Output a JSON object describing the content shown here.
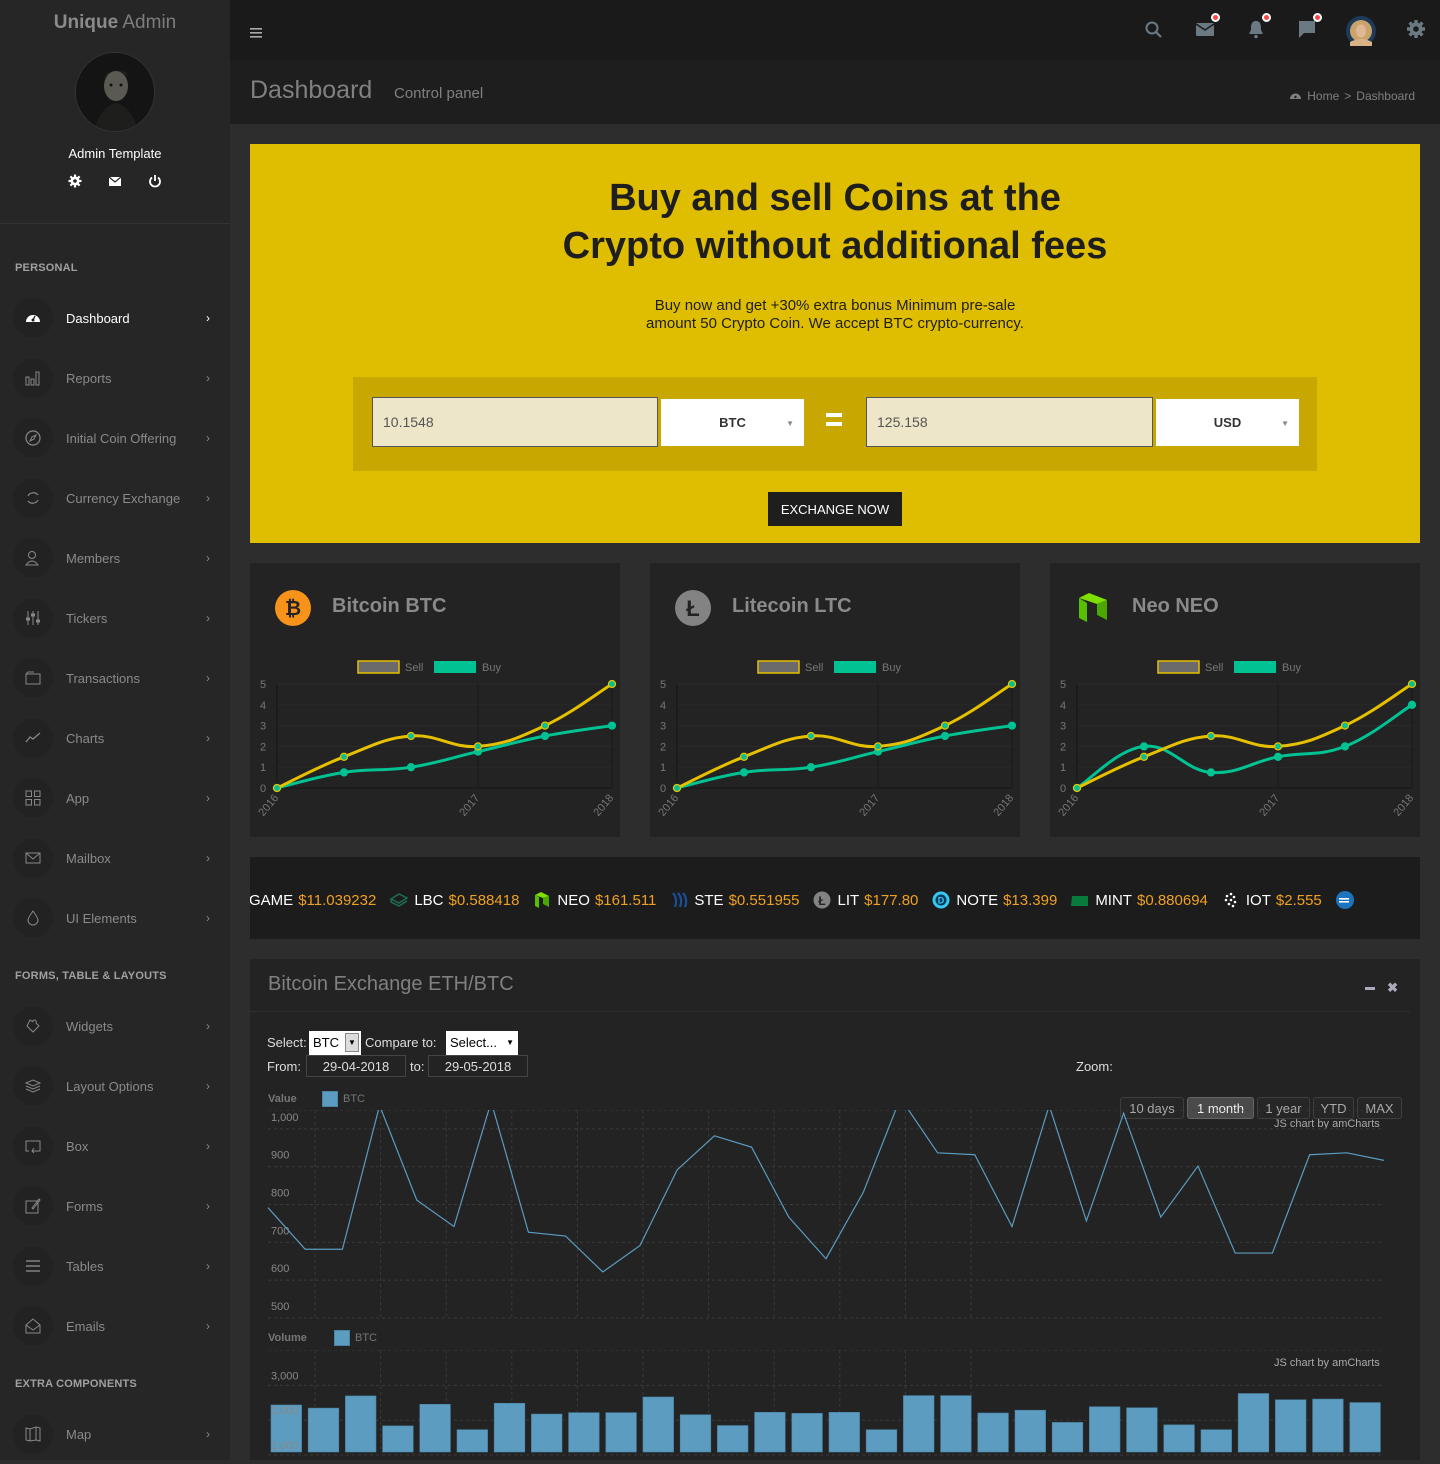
{
  "app": {
    "brand_bold": "Unique",
    "brand_light": " Admin"
  },
  "user": {
    "name": "Admin Template",
    "icons": [
      "gear-icon",
      "mail-icon",
      "power-icon"
    ]
  },
  "sidebar": {
    "sections": [
      {
        "header": "PERSONAL",
        "items": [
          {
            "label": "Dashboard",
            "icon": "dashboard-icon",
            "active": true
          },
          {
            "label": "Reports",
            "icon": "bar-chart-icon"
          },
          {
            "label": "Initial Coin Offering",
            "icon": "compass-icon"
          },
          {
            "label": "Currency Exchange",
            "icon": "refresh-icon"
          },
          {
            "label": "Members",
            "icon": "users-icon"
          },
          {
            "label": "Tickers",
            "icon": "sliders-icon"
          },
          {
            "label": "Transactions",
            "icon": "wallet-icon"
          },
          {
            "label": "Charts",
            "icon": "trend-icon"
          },
          {
            "label": "App",
            "icon": "grid-icon"
          },
          {
            "label": "Mailbox",
            "icon": "mail-icon"
          },
          {
            "label": "UI Elements",
            "icon": "drop-icon"
          }
        ]
      },
      {
        "header": "FORMS, TABLE & LAYOUTS",
        "items": [
          {
            "label": "Widgets",
            "icon": "puzzle-icon"
          },
          {
            "label": "Layout Options",
            "icon": "layers-icon"
          },
          {
            "label": "Box",
            "icon": "box-icon"
          },
          {
            "label": "Forms",
            "icon": "edit-icon"
          },
          {
            "label": "Tables",
            "icon": "menu-icon"
          },
          {
            "label": "Emails",
            "icon": "envelope-open-icon"
          }
        ]
      },
      {
        "header": "EXTRA COMPONENTS",
        "items": [
          {
            "label": "Map",
            "icon": "map-icon"
          }
        ]
      }
    ]
  },
  "topbar": {
    "icons": [
      "search-icon",
      "mail-icon",
      "bell-icon",
      "chat-icon",
      "user-avatar",
      "gear-icon"
    ]
  },
  "page": {
    "title": "Dashboard",
    "subtitle": "Control panel",
    "breadcrumb": [
      "Home",
      "Dashboard"
    ]
  },
  "hero": {
    "title_line1": "Buy and sell Coins at the",
    "title_line2": "Crypto without additional fees",
    "text_line1": "Buy now and get +30% extra bonus Minimum pre-sale",
    "text_line2": "amount 50 Crypto Coin. We accept BTC crypto-currency.",
    "from_amount": "10.1548",
    "from_currency": "BTC",
    "to_amount": "125.158",
    "to_currency": "USD",
    "button": "EXCHANGE NOW",
    "color": "#dfbd00"
  },
  "coins": [
    {
      "name": "Bitcoin BTC",
      "icon": "bitcoin-icon",
      "color": "#f7931a"
    },
    {
      "name": "Litecoin LTC",
      "icon": "litecoin-icon",
      "color": "#838383"
    },
    {
      "name": "Neo NEO",
      "icon": "neo-icon",
      "color": "#58bf00"
    }
  ],
  "chart_data": [
    {
      "type": "line",
      "title": "Bitcoin BTC",
      "x": [
        "2016",
        "",
        "",
        "2017",
        "",
        "2018"
      ],
      "tick_labels": [
        "2016",
        "2017",
        "2018"
      ],
      "ylim": [
        0,
        5
      ],
      "yticks": [
        0,
        1,
        2,
        3,
        4,
        5
      ],
      "legend": [
        "Sell",
        "Buy"
      ],
      "series": [
        {
          "name": "Sell",
          "color": "#e6c000",
          "values": [
            0,
            1.5,
            2.5,
            2,
            3,
            5
          ]
        },
        {
          "name": "Buy",
          "color": "#00c292",
          "values": [
            0,
            0.75,
            1,
            1.75,
            2.5,
            3
          ]
        }
      ]
    },
    {
      "type": "line",
      "title": "Litecoin LTC",
      "x": [
        "2016",
        "",
        "",
        "2017",
        "",
        "2018"
      ],
      "tick_labels": [
        "2016",
        "2017",
        "2018"
      ],
      "ylim": [
        0,
        5
      ],
      "yticks": [
        0,
        1,
        2,
        3,
        4,
        5
      ],
      "legend": [
        "Sell",
        "Buy"
      ],
      "series": [
        {
          "name": "Sell",
          "color": "#e6c000",
          "values": [
            0,
            1.5,
            2.5,
            2,
            3,
            5
          ]
        },
        {
          "name": "Buy",
          "color": "#00c292",
          "values": [
            0,
            0.75,
            1,
            1.75,
            2.5,
            3
          ]
        }
      ]
    },
    {
      "type": "line",
      "title": "Neo NEO",
      "x": [
        "2016",
        "",
        "",
        "2017",
        "",
        "2018"
      ],
      "tick_labels": [
        "2016",
        "2017",
        "2018"
      ],
      "ylim": [
        0,
        5
      ],
      "yticks": [
        0,
        1,
        2,
        3,
        4,
        5
      ],
      "legend": [
        "Sell",
        "Buy"
      ],
      "series": [
        {
          "name": "Sell",
          "color": "#e6c000",
          "values": [
            0,
            1.5,
            2.5,
            2,
            3,
            5
          ]
        },
        {
          "name": "Buy",
          "color": "#00c292",
          "values": [
            0,
            2,
            0.75,
            1.5,
            2,
            4
          ]
        }
      ]
    },
    {
      "type": "line",
      "title": "Value",
      "legend": [
        "BTC"
      ],
      "ylim": [
        500,
        1050
      ],
      "yticks": [
        500,
        600,
        700,
        800,
        900,
        1000
      ],
      "ytick_labels": [
        "500",
        "600",
        "700",
        "800",
        "900",
        "1,000"
      ],
      "series": [
        {
          "name": "BTC",
          "color": "#5b9cc0",
          "values": [
            760,
            650,
            650,
            1030,
            780,
            710,
            1040,
            695,
            685,
            590,
            660,
            860,
            950,
            920,
            735,
            625,
            800,
            1050,
            905,
            900,
            710,
            1030,
            725,
            1010,
            735,
            870,
            640,
            640,
            900,
            905,
            885
          ]
        }
      ],
      "credit": "JS chart by amCharts"
    },
    {
      "type": "bar",
      "title": "Volume",
      "legend": [
        "BTC"
      ],
      "ylim": [
        800,
        3500
      ],
      "yticks": [
        1000,
        2000,
        3000
      ],
      "ytick_labels": [
        "1,000",
        "2,000",
        "3,000"
      ],
      "series": [
        {
          "name": "BTC",
          "color": "#5b9cc0",
          "values": [
            2150,
            2060,
            2410,
            1550,
            2170,
            1440,
            2200,
            1890,
            1930,
            1930,
            2380,
            1870,
            1560,
            1940,
            1910,
            1940,
            1440,
            2420,
            2420,
            1920,
            2000,
            1650,
            2100,
            2070,
            1580,
            1440,
            2480,
            2300,
            2320,
            2220
          ]
        }
      ],
      "credit": "JS chart by amCharts"
    }
  ],
  "ticker": [
    {
      "symbol": "GAME",
      "price": "$11.039232",
      "icon": "game-icon",
      "color": "#2e77bc"
    },
    {
      "symbol": "LBC",
      "price": "$0.588418",
      "icon": "lbc-icon",
      "color": "#1d6e52"
    },
    {
      "symbol": "NEO",
      "price": "$161.511",
      "icon": "neo-icon",
      "color": "#58bf00"
    },
    {
      "symbol": "STE",
      "price": "$0.551955",
      "icon": "steem-icon",
      "color": "#1a5099"
    },
    {
      "symbol": "LIT",
      "price": "$177.80",
      "icon": "litecoin-icon",
      "color": "#838383"
    },
    {
      "symbol": "NOTE",
      "price": "$13.399",
      "icon": "dnote-icon",
      "color": "#34c9f0"
    },
    {
      "symbol": "MINT",
      "price": "$0.880694",
      "icon": "mint-icon",
      "color": "#087a3b"
    },
    {
      "symbol": "IOT",
      "price": "$2.555",
      "icon": "iota-icon",
      "color": "#ffffff"
    },
    {
      "symbol": "",
      "price": "",
      "icon": "dash-icon",
      "color": "#1c75bc"
    }
  ],
  "exchange_panel": {
    "title": "Bitcoin Exchange ETH/BTC",
    "select_label": "Select:",
    "select_value": "BTC",
    "compare_label": "Compare to:",
    "compare_value": "Select...",
    "from_label": "From:",
    "from_date": "29-04-2018",
    "to_label": "to:",
    "to_date": "29-05-2018",
    "zoom_label": "Zoom:",
    "zoom_options": [
      "10 days",
      "1 month",
      "1 year",
      "YTD",
      "MAX"
    ],
    "zoom_selected": "1 month",
    "value_label": "Value",
    "volume_label": "Volume",
    "legend_series": "BTC"
  }
}
